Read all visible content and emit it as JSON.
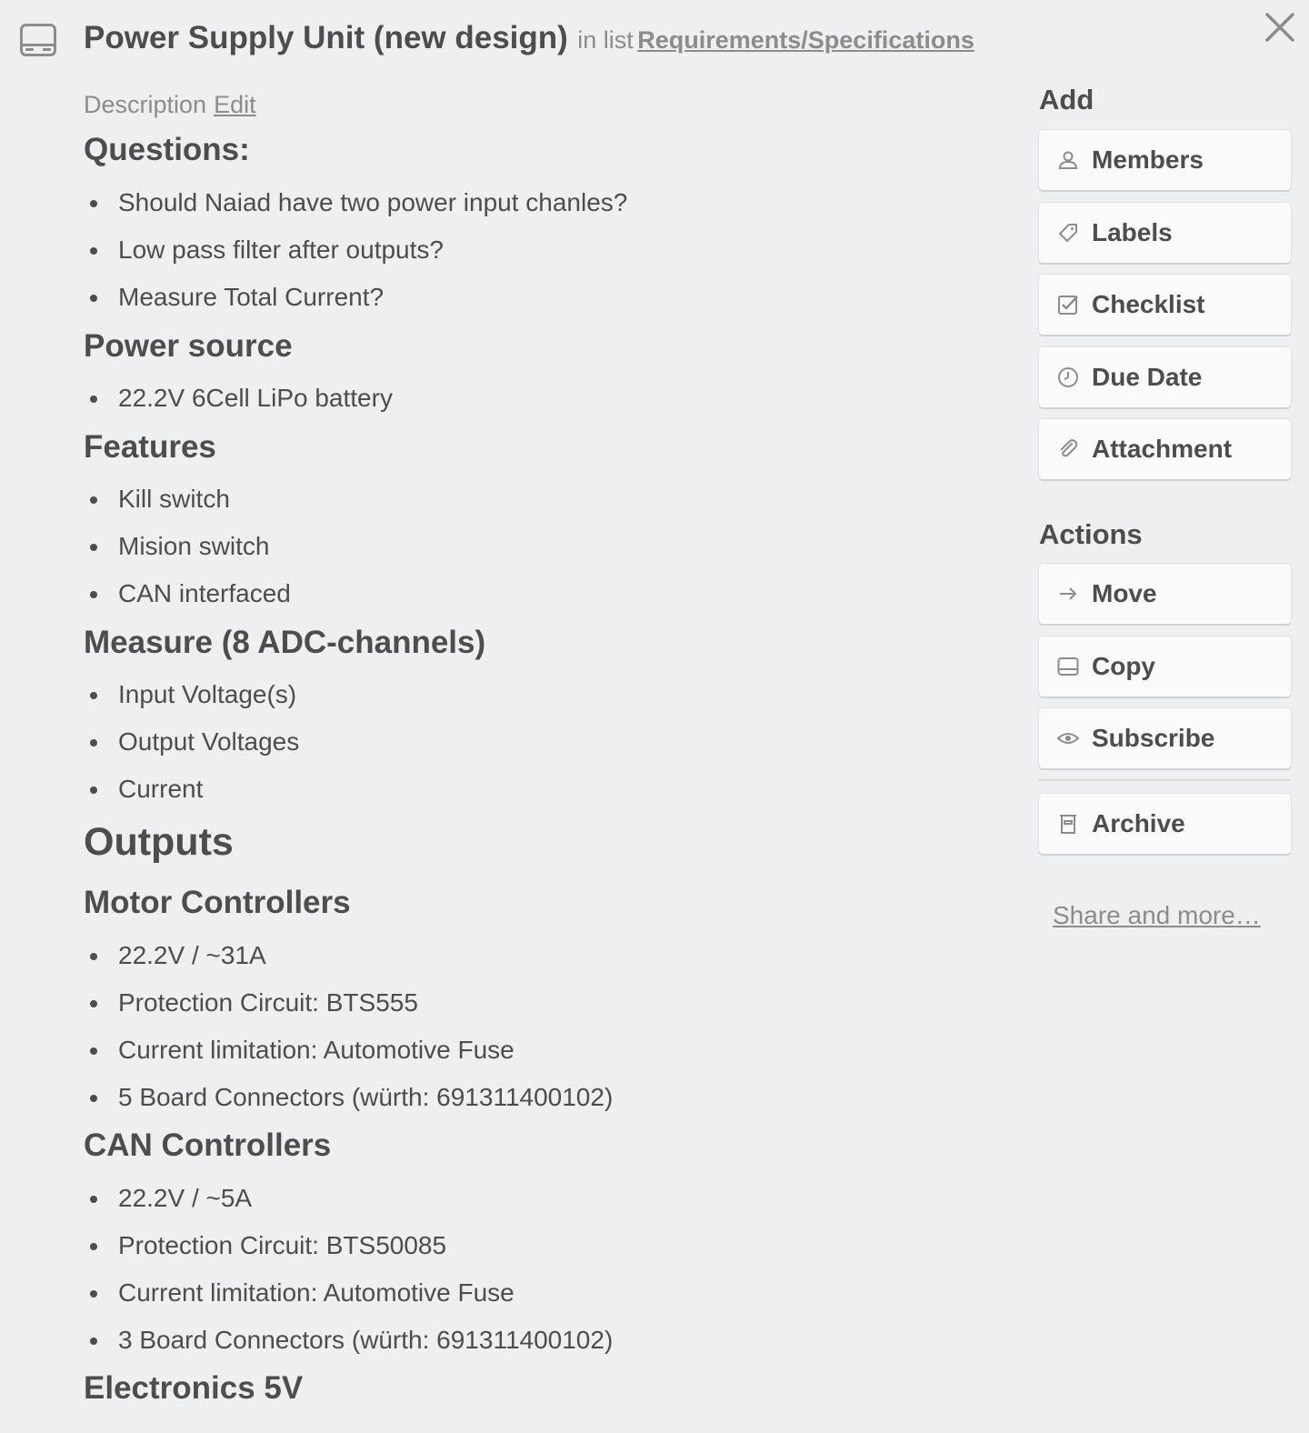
{
  "card": {
    "title": "Power Supply Unit (new design)",
    "in_list_prefix": "in list",
    "list_name": "Requirements/Specifications"
  },
  "description": {
    "label": "Description",
    "edit_label": "Edit",
    "sections": {
      "questions": {
        "heading": "Questions:",
        "items": [
          "Should Naiad have two power input chanles?",
          "Low pass filter after outputs?",
          "Measure Total Current?"
        ]
      },
      "power_source": {
        "heading": "Power source",
        "items": [
          "22.2V 6Cell LiPo battery"
        ]
      },
      "features": {
        "heading": "Features",
        "items": [
          "Kill switch",
          "Mision switch",
          "CAN interfaced"
        ]
      },
      "measure": {
        "heading": "Measure (8 ADC-channels)",
        "items": [
          "Input Voltage(s)",
          "Output Voltages",
          "Current"
        ]
      },
      "outputs": {
        "heading": "Outputs"
      },
      "motor_controllers": {
        "heading": "Motor Controllers",
        "items": [
          "22.2V / ~31A",
          "Protection Circuit: BTS555",
          "Current limitation: Automotive Fuse",
          "5 Board Connectors (würth: 691311400102)"
        ]
      },
      "can_controllers": {
        "heading": "CAN Controllers",
        "items": [
          "22.2V / ~5A",
          "Protection Circuit: BTS50085",
          "Current limitation: Automotive Fuse",
          "3 Board Connectors (würth: 691311400102)"
        ]
      },
      "electronics": {
        "heading": "Electronics 5V"
      }
    }
  },
  "sidebar": {
    "add_heading": "Add",
    "add_buttons": [
      {
        "label": "Members",
        "icon": "person-icon"
      },
      {
        "label": "Labels",
        "icon": "tag-icon"
      },
      {
        "label": "Checklist",
        "icon": "checkbox-icon"
      },
      {
        "label": "Due Date",
        "icon": "clock-icon"
      },
      {
        "label": "Attachment",
        "icon": "paperclip-icon"
      }
    ],
    "actions_heading": "Actions",
    "action_buttons": [
      {
        "label": "Move",
        "icon": "arrow-right-icon"
      },
      {
        "label": "Copy",
        "icon": "card-icon"
      },
      {
        "label": "Subscribe",
        "icon": "eye-icon"
      },
      {
        "label": "Archive",
        "icon": "archive-icon"
      }
    ],
    "share_label": "Share and more…"
  }
}
